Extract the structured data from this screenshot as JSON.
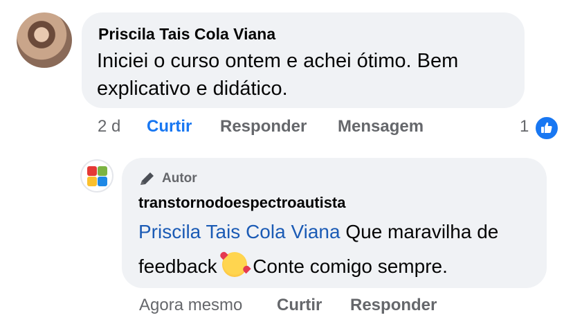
{
  "comment": {
    "author": "Priscila Tais Cola Viana",
    "text": "Iniciei o curso ontem e achei ótimo.  Bem explicativo e didático.",
    "time": "2 d",
    "like_label": "Curtir",
    "reply_label": "Responder",
    "message_label": "Mensagem",
    "reaction_count": "1",
    "reaction_icon": "thumbs-up-icon",
    "like_color": "#1877f2"
  },
  "reply": {
    "badge_icon": "pencil-icon",
    "badge_label": "Autor",
    "author": "transtornodoespectroautista",
    "mention": "Priscila Tais Cola Viana",
    "text_part1": " Que maravilha de feedback ",
    "emoji_icon": "smiling-face-with-hearts-icon",
    "text_part2": " Conte comigo sempre.",
    "time": "Agora mesmo",
    "like_label": "Curtir",
    "reply_label": "Responder",
    "mention_color": "#1b5bb5"
  }
}
